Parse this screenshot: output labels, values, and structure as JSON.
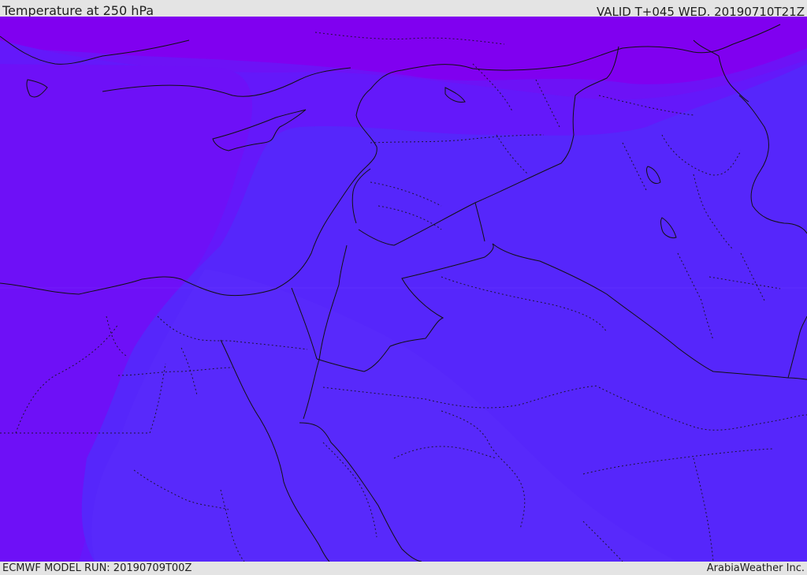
{
  "header": {
    "title": "Temperature at 250 hPa",
    "valid_time": "VALID T+045 WED. 20190710T21Z"
  },
  "footer": {
    "model_run": "ECMWF MODEL RUN: 20190709T00Z",
    "credit": "ArabiaWeather Inc."
  },
  "colors": {
    "coldest_band": "#8000f0",
    "cold_band": "#7010f6",
    "mid_band": "#6418fa",
    "warm_band": "#5626fb",
    "warmest_band": "#5a2afc",
    "land_borders": "#111111"
  },
  "map": {
    "region": "Eastern Mediterranean and Middle East",
    "field": "250 hPa temperature",
    "features": [
      "coastlines",
      "country borders",
      "province borders"
    ]
  }
}
